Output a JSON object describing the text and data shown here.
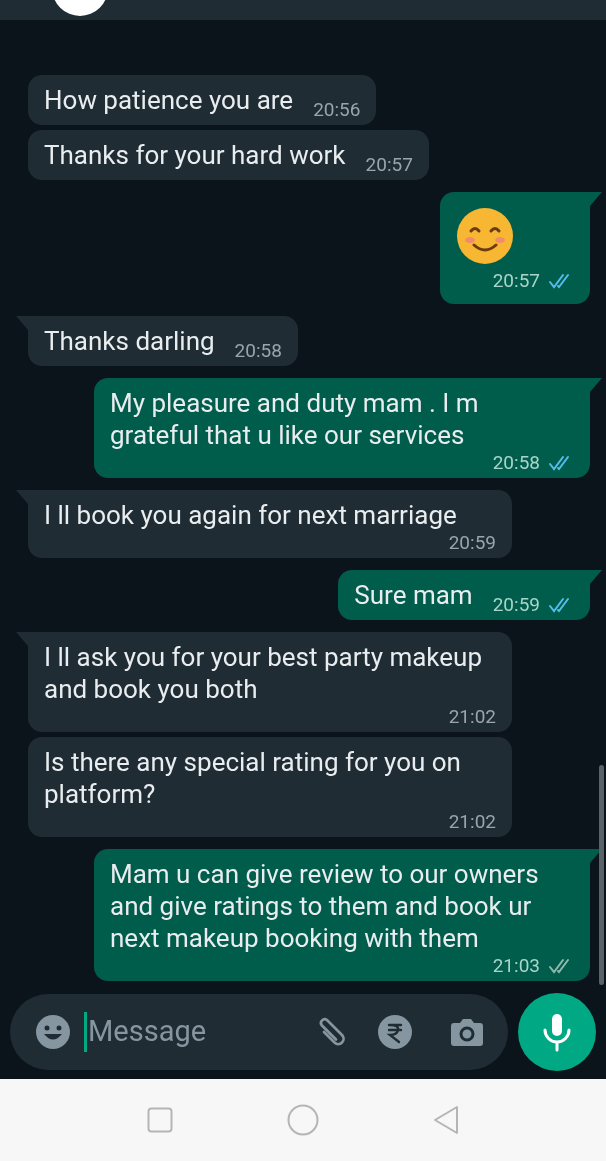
{
  "messages": [
    {
      "kind": "text",
      "outgoing": false,
      "tail": false,
      "text": "How patience you are",
      "time": "20:56"
    },
    {
      "kind": "text",
      "outgoing": false,
      "tail": false,
      "text": "Thanks for your hard work",
      "time": "20:57"
    },
    {
      "kind": "emoji",
      "outgoing": true,
      "tail": true,
      "time": "20:57",
      "read": true
    },
    {
      "kind": "text",
      "outgoing": false,
      "tail": true,
      "text": "Thanks darling",
      "time": "20:58"
    },
    {
      "kind": "text",
      "outgoing": true,
      "tail": true,
      "text": "My pleasure and duty mam . I m grateful that u like our services",
      "time": "20:58",
      "read": true
    },
    {
      "kind": "text",
      "outgoing": false,
      "tail": true,
      "text": "I ll book you again for next marriage",
      "time": "20:59"
    },
    {
      "kind": "text",
      "outgoing": true,
      "tail": true,
      "text": "Sure mam",
      "time": "20:59",
      "read": true
    },
    {
      "kind": "text",
      "outgoing": false,
      "tail": true,
      "text": "I ll ask you for your best party makeup and book you both",
      "time": "21:02"
    },
    {
      "kind": "text",
      "outgoing": false,
      "tail": false,
      "text": "Is there any special rating for you on platform?",
      "time": "21:02"
    },
    {
      "kind": "text",
      "outgoing": true,
      "tail": true,
      "text": "Mam u can give review to our owners and give ratings to them and book ur next makeup booking with them",
      "time": "21:03",
      "read": false
    }
  ],
  "composer": {
    "placeholder": "Message"
  }
}
